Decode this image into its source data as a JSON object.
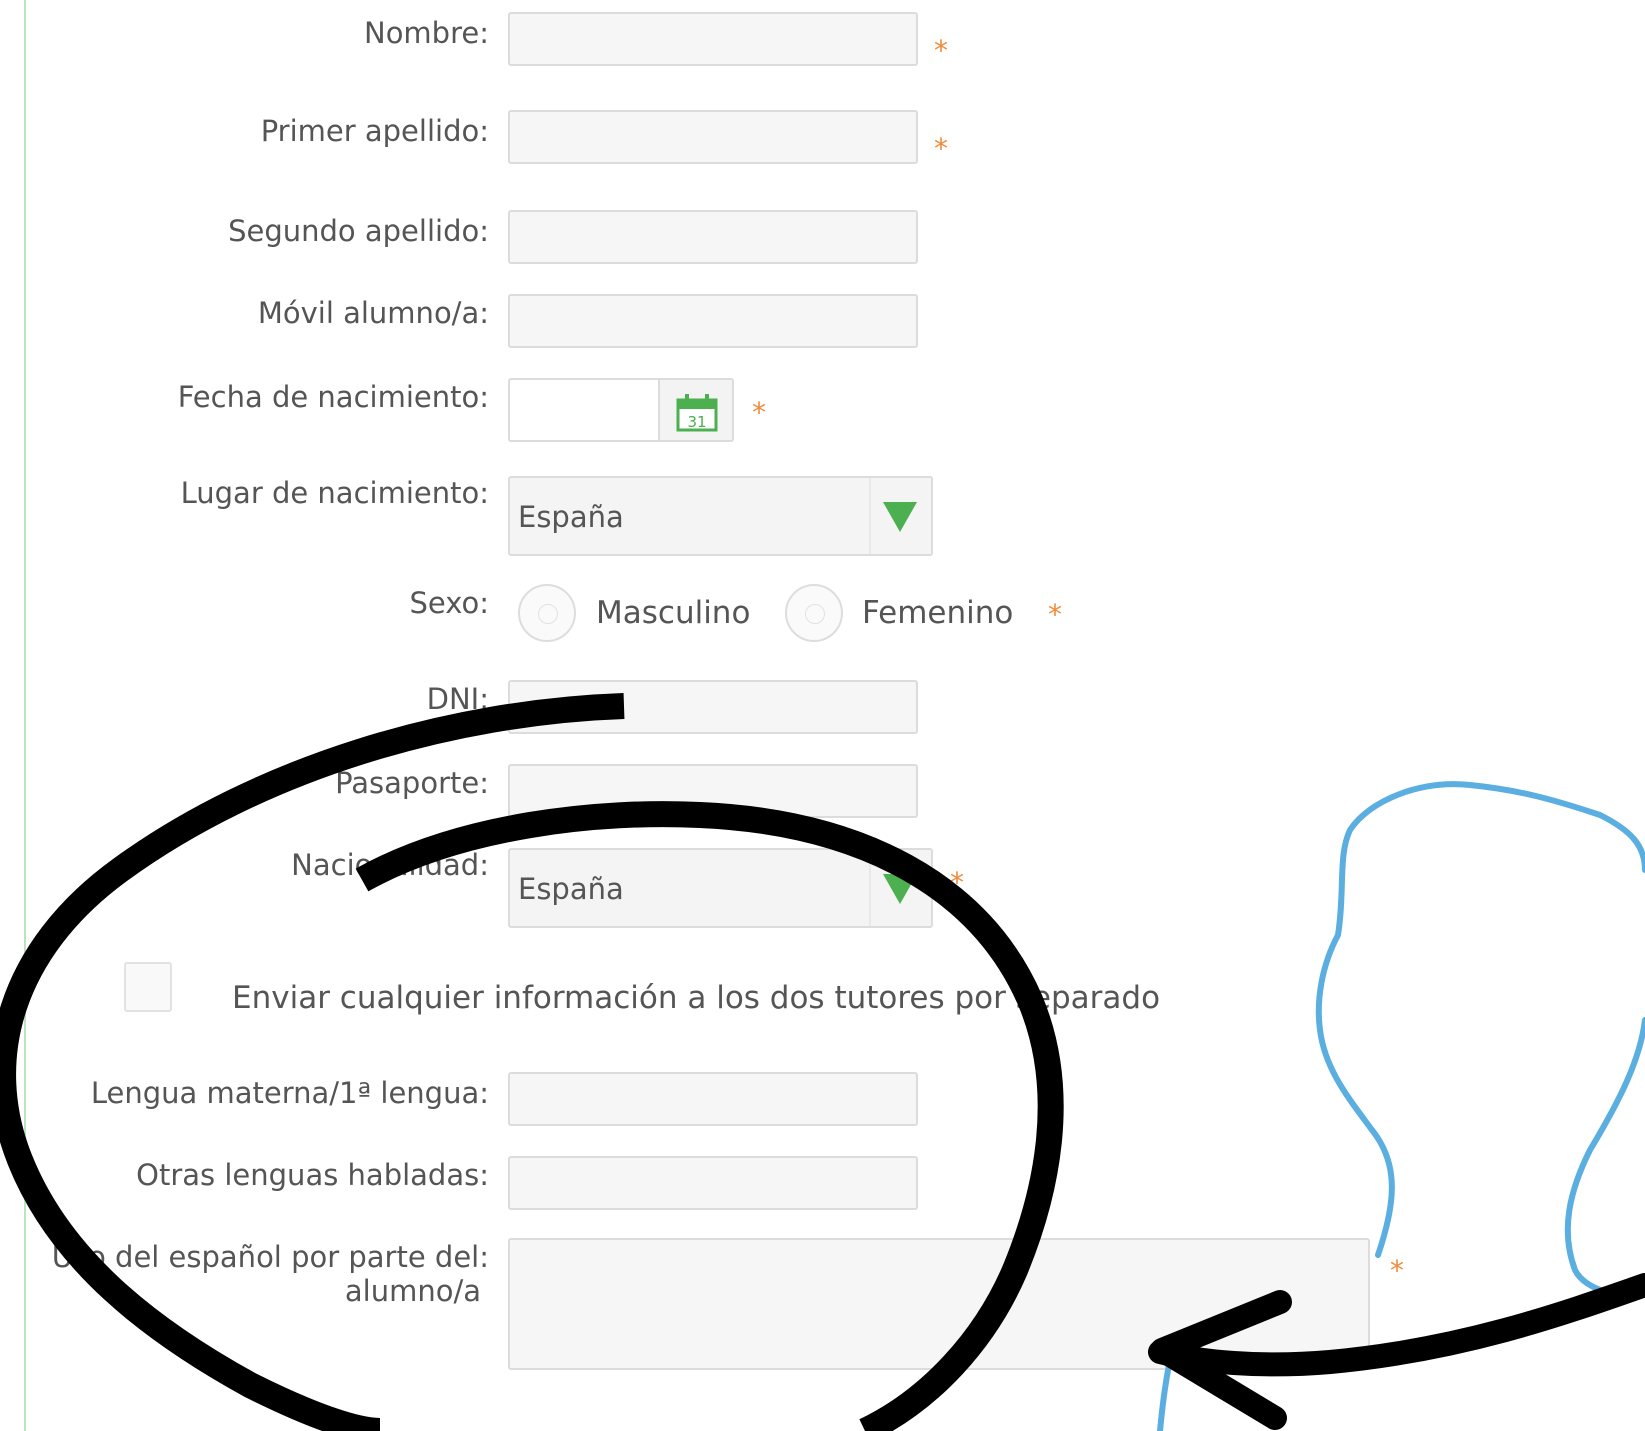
{
  "form": {
    "nombre_label": "Nombre:",
    "primer_apellido_label": "Primer apellido:",
    "segundo_apellido_label": "Segundo apellido:",
    "movil_label": "Móvil alumno/a:",
    "fecha_label": "Fecha de nacimiento:",
    "calendar_day": "31",
    "lugar_label": "Lugar de nacimiento:",
    "lugar_value": "España",
    "sexo_label": "Sexo:",
    "sexo_options": [
      "Masculino",
      "Femenino"
    ],
    "dni_label": "DNI:",
    "pasaporte_label": "Pasaporte:",
    "nacionalidad_label": "Nacionalidad:",
    "nacionalidad_value": "España",
    "enviar_label": "Enviar cualquier información a los dos tutores por separado",
    "lengua_materna_label": "Lengua materna/1ª lengua:",
    "otras_lenguas_label": "Otras lenguas habladas:",
    "uso_espanol_label_line1": "Uso del español por parte del:",
    "uso_espanol_label_line2": "alumno/a",
    "required_marker": "*"
  },
  "colors": {
    "accent_green": "#4caf50",
    "required_orange": "#f28a3a",
    "annotation_black": "#000000",
    "silhouette_blue": "#5aaee0"
  },
  "icons": [
    "calendar-icon",
    "dropdown-arrow-icon",
    "person-silhouette-icon",
    "arrow-annotation-icon"
  ]
}
